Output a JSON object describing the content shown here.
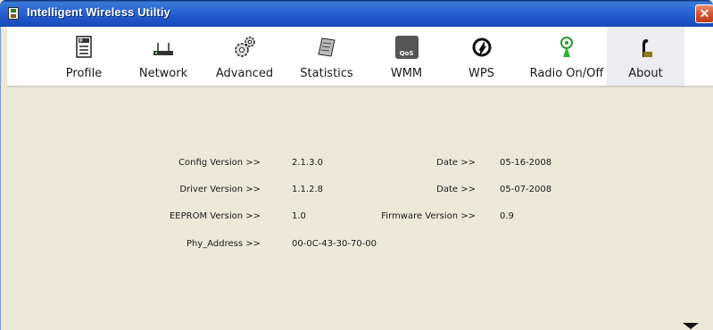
{
  "window": {
    "title": "Intelligent Wireless Utiltiy",
    "title_icon": "app-card-icon",
    "close_glyph": "✕"
  },
  "toolbar": {
    "items": [
      {
        "label": "Profile",
        "icon": "profile-icon"
      },
      {
        "label": "Network",
        "icon": "network-icon"
      },
      {
        "label": "Advanced",
        "icon": "advanced-icon"
      },
      {
        "label": "Statistics",
        "icon": "statistics-icon"
      },
      {
        "label": "WMM",
        "icon": "wmm-qos-icon",
        "icon_text": "QoS"
      },
      {
        "label": "WPS",
        "icon": "wps-icon"
      },
      {
        "label": "Radio On/Off",
        "icon": "radio-icon"
      },
      {
        "label": "About",
        "icon": "about-icon",
        "active": true
      }
    ]
  },
  "about": {
    "config_version_label": "Config Version >>",
    "config_version": "2.1.3.0",
    "config_date_label": "Date >>",
    "config_date": "05-16-2008",
    "driver_version_label": "Driver Version >>",
    "driver_version": "1.1.2.8",
    "driver_date_label": "Date >>",
    "driver_date": "05-07-2008",
    "eeprom_version_label": "EEPROM Version >>",
    "eeprom_version": "1.0",
    "firmware_version_label": "Firmware Version >>",
    "firmware_version": "0.9",
    "phy_address_label": "Phy_Address >>",
    "phy_address": "00-0C-43-30-70-00"
  },
  "colors": {
    "titlebar": "#2c66d6",
    "close": "#d8522f",
    "background": "#ece9d8",
    "active_tab": "#ececf1"
  }
}
